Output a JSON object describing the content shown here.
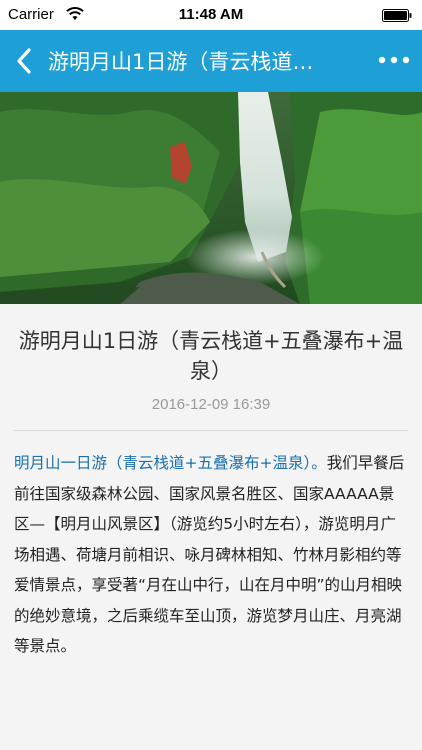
{
  "status_bar": {
    "carrier": "Carrier",
    "time": "11:48 AM"
  },
  "nav": {
    "title": "游明月山1日游（青云栈道…",
    "back_icon": "chevron-left-icon",
    "more_icon": "more-dots-icon",
    "color": "#1e9fd6"
  },
  "hero": {
    "alt": "waterfall-in-forest-photo"
  },
  "article": {
    "title": "游明月山1日游（青云栈道+五叠瀑布+温泉）",
    "date": "2016-12-09 16:39",
    "body_lead": "明月山一日游（青云栈道+五叠瀑布+温泉）。",
    "body_rest": "我们早餐后前往国家级森林公园、国家风景名胜区、国家AAAAA景区—【明月山风景区】（游览约5小时左右），游览明月广场相遇、荷塘月前相识、咏月碑林相知、竹林月影相约等爱情景点，享受著“月在山中行，山在月中明”的山月相映的绝妙意境，之后乘缆车至山顶，游览梦月山庄、月亮湖等景点。"
  }
}
